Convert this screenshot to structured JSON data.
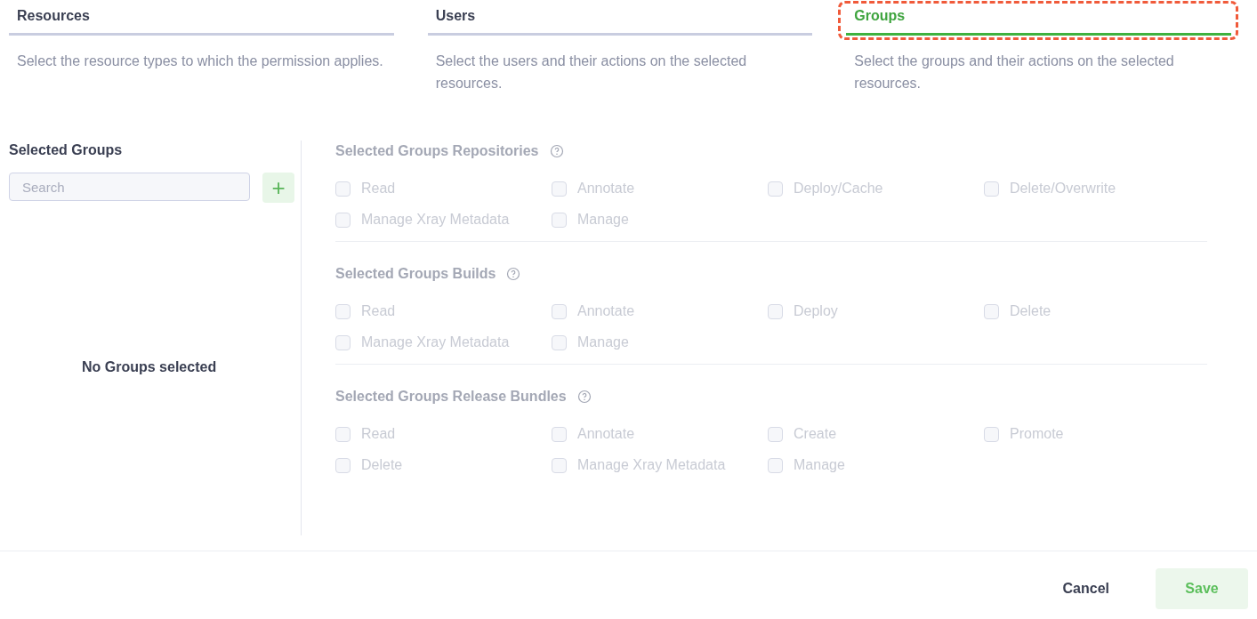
{
  "tabs": [
    {
      "label": "Resources",
      "selected": false,
      "description": "Select the resource types to which the permission applies."
    },
    {
      "label": "Users",
      "selected": false,
      "description": "Select the users and their actions on the selected resources."
    },
    {
      "label": "Groups",
      "selected": true,
      "highlighted": true,
      "description": "Select the groups and their actions on the selected resources."
    }
  ],
  "selected_groups": {
    "title": "Selected Groups",
    "search": {
      "placeholder": "Search"
    },
    "add_button": {
      "label": "+"
    },
    "empty_message": "No Groups selected"
  },
  "sections": [
    {
      "title": "Selected Groups Repositories",
      "disabled": true,
      "permissions": [
        {
          "label": "Read",
          "checked": false
        },
        {
          "label": "Annotate",
          "checked": false
        },
        {
          "label": "Deploy/Cache",
          "checked": false
        },
        {
          "label": "Delete/Overwrite",
          "checked": false
        },
        {
          "label": "Manage Xray Metadata",
          "checked": false
        },
        {
          "label": "Manage",
          "checked": false
        }
      ]
    },
    {
      "title": "Selected Groups Builds",
      "disabled": true,
      "permissions": [
        {
          "label": "Read",
          "checked": false
        },
        {
          "label": "Annotate",
          "checked": false
        },
        {
          "label": "Deploy",
          "checked": false
        },
        {
          "label": "Delete",
          "checked": false
        },
        {
          "label": "Manage Xray Metadata",
          "checked": false
        },
        {
          "label": "Manage",
          "checked": false
        }
      ]
    },
    {
      "title": "Selected Groups Release Bundles",
      "disabled": true,
      "permissions": [
        {
          "label": "Read",
          "checked": false
        },
        {
          "label": "Annotate",
          "checked": false
        },
        {
          "label": "Create",
          "checked": false
        },
        {
          "label": "Promote",
          "checked": false
        },
        {
          "label": "Delete",
          "checked": false
        },
        {
          "label": "Manage Xray Metadata",
          "checked": false
        },
        {
          "label": "Manage",
          "checked": false
        }
      ]
    }
  ],
  "footer": {
    "cancel": {
      "label": "Cancel"
    },
    "save": {
      "label": "Save",
      "disabled": true
    }
  }
}
